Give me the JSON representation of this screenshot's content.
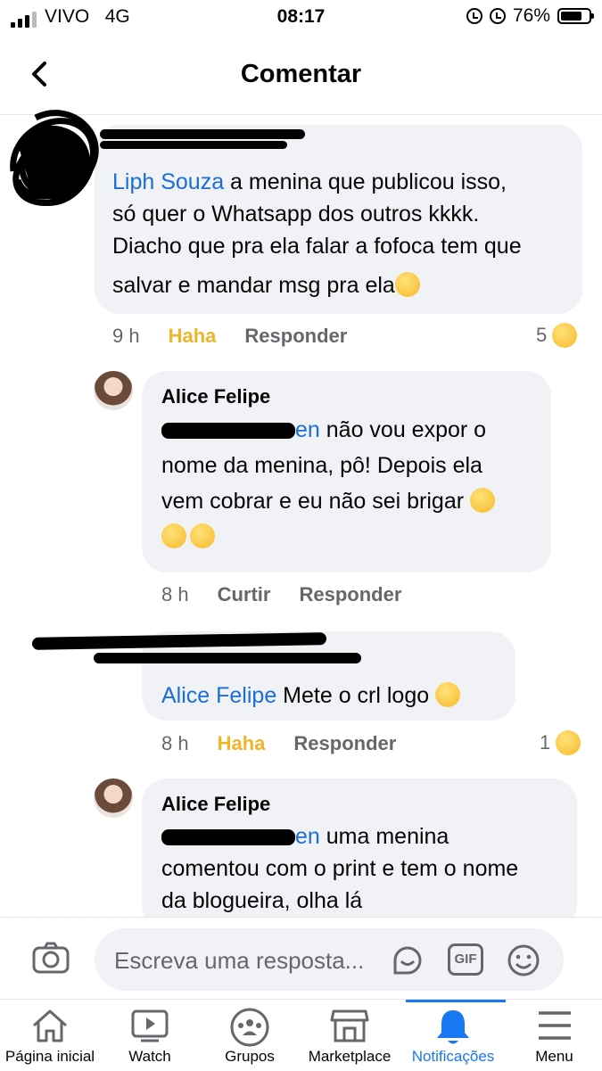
{
  "status_bar": {
    "carrier": "VIVO",
    "network": "4G",
    "time": "08:17",
    "battery": "76%",
    "battery_level": 0.76
  },
  "header": {
    "title": "Comentar"
  },
  "comments": [
    {
      "mention": "Liph Souza",
      "lines": [
        " a menina que publicou isso,",
        "só quer o Whatsapp dos outros kkkk.",
        "Diacho que pra ela falar a fofoca tem que",
        "salvar e  mandar msg pra ela"
      ],
      "time": "9 h",
      "reaction_label": "Haha",
      "reply_label": "Responder",
      "reaction_count": "5"
    },
    {
      "author": "Alice Felipe",
      "mention": "en",
      "lines": [
        " não vou expor o",
        "nome da menina, pô! Depois ela",
        "vem cobrar e eu não sei brigar"
      ],
      "time": "8 h",
      "like_label": "Curtir",
      "reply_label": "Responder"
    },
    {
      "mention": "Alice Felipe",
      "text": " Mete o crl logo",
      "time": "8 h",
      "reaction_label": "Haha",
      "reply_label": "Responder",
      "reaction_count": "1"
    },
    {
      "author": "Alice Felipe",
      "mention": "en",
      "lines": [
        " uma menina",
        "comentou com o print e tem o nome",
        "da blogueira, olha lá"
      ]
    }
  ],
  "composer": {
    "placeholder": "Escreva uma resposta...",
    "gif_label": "GIF"
  },
  "nav": {
    "items": [
      {
        "label": "Página inicial",
        "icon": "home-icon"
      },
      {
        "label": "Watch",
        "icon": "watch-icon"
      },
      {
        "label": "Grupos",
        "icon": "groups-icon"
      },
      {
        "label": "Marketplace",
        "icon": "marketplace-icon"
      },
      {
        "label": "Notificações",
        "icon": "bell-icon",
        "active": true
      },
      {
        "label": "Menu",
        "icon": "menu-icon"
      }
    ]
  },
  "colors": {
    "accent": "#1877f2",
    "mention": "#1a6ed8",
    "haha": "#f0b429",
    "bubble": "#f0f2f5",
    "secondary_text": "#65676b"
  }
}
